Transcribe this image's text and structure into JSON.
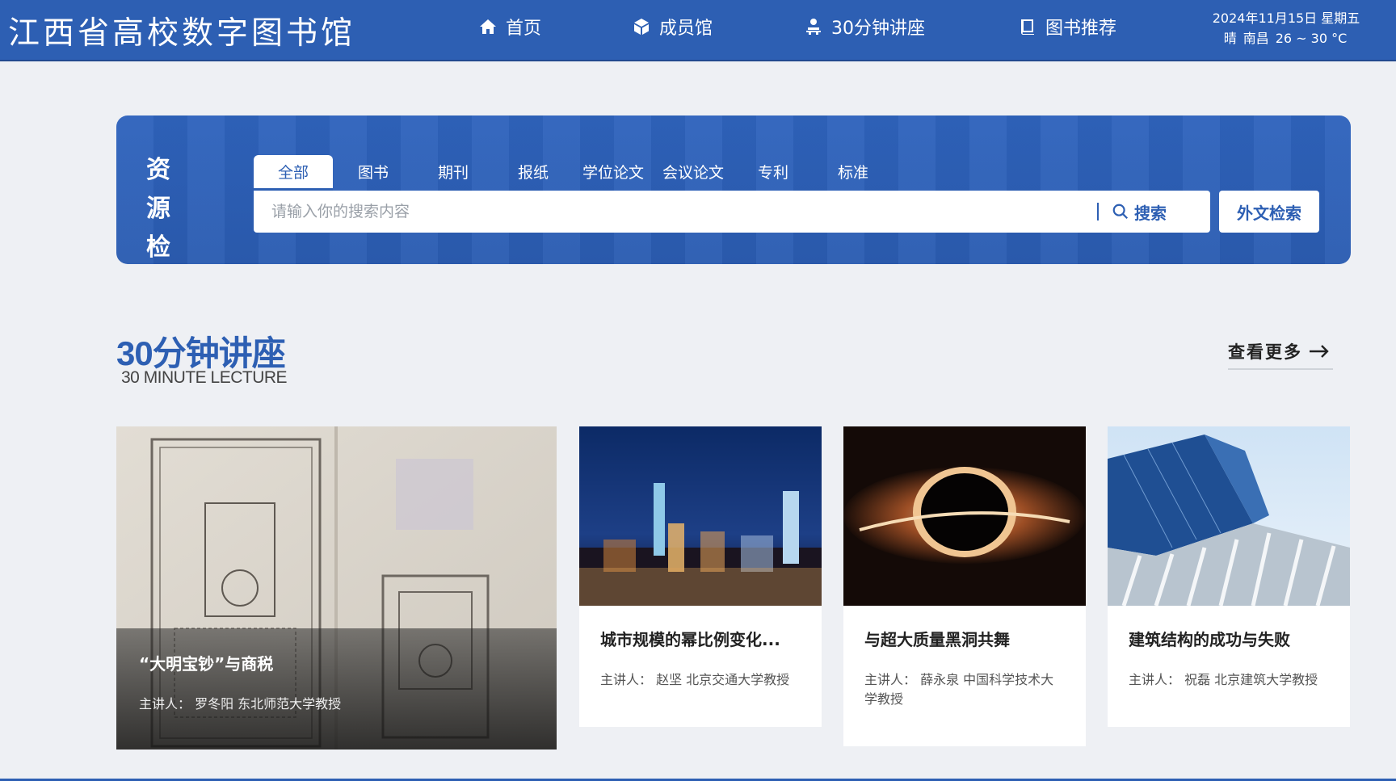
{
  "header": {
    "site_title": "江西省高校数字图书馆",
    "nav": [
      {
        "label": "首页",
        "icon": "home-icon"
      },
      {
        "label": "成员馆",
        "icon": "cube-icon"
      },
      {
        "label": "30分钟讲座",
        "icon": "lecturer-icon"
      },
      {
        "label": "图书推荐",
        "icon": "book-icon"
      }
    ],
    "date": "2024年11月15日 星期五",
    "weather": {
      "condition": "晴",
      "city": "南昌",
      "temperature": "26 ~ 30 °C"
    }
  },
  "search": {
    "label_line1": "资 源",
    "label_line2": "检 索",
    "tabs": [
      "全部",
      "图书",
      "期刊",
      "报纸",
      "学位论文",
      "会议论文",
      "专利",
      "标准"
    ],
    "active_tab": "全部",
    "placeholder": "请输入你的搜索内容",
    "search_button": "搜索",
    "foreign_button": "外文检索"
  },
  "lectures": {
    "title": "30分钟讲座",
    "subtitle": "30 MINUTE LECTURE",
    "more_label": "查看更多",
    "featured": {
      "title": "“大明宝钞”与商税",
      "speaker": "主讲人：  罗冬阳 东北师范大学教授"
    },
    "cards": [
      {
        "title": "城市规模的幂比例变化...",
        "speaker": "主讲人：  赵坚 北京交通大学教授"
      },
      {
        "title": "与超大质量黑洞共舞",
        "speaker": "主讲人：  薛永泉 中国科学技术大学教授"
      },
      {
        "title": "建筑结构的成功与失败",
        "speaker": "主讲人：  祝磊 北京建筑大学教授"
      }
    ]
  },
  "colors": {
    "brand": "#2d5fb3",
    "background": "#eef0f4"
  }
}
